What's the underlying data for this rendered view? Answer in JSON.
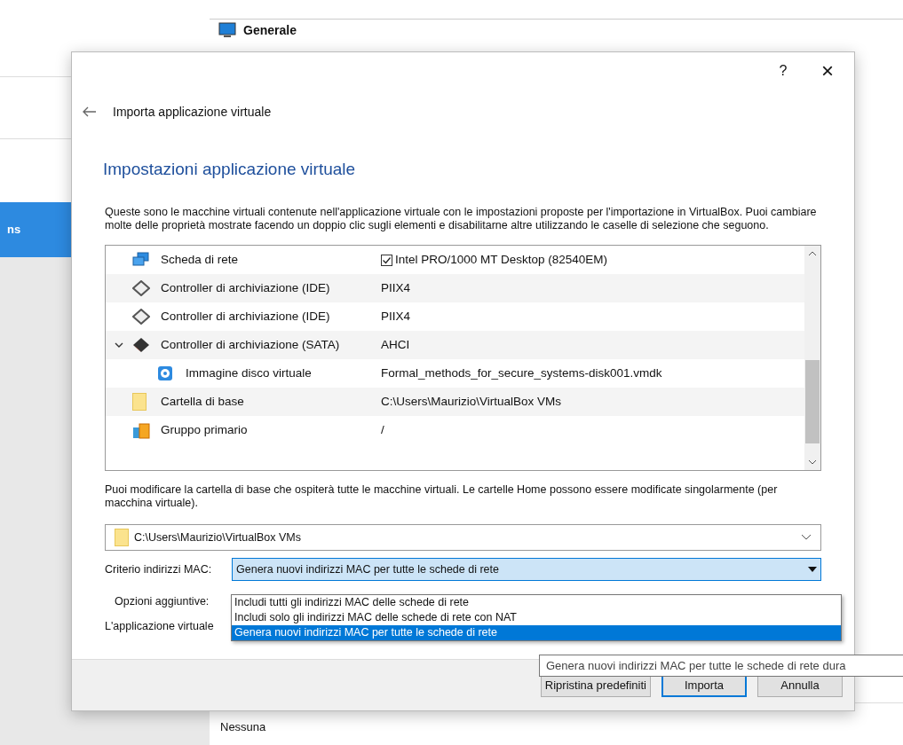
{
  "background": {
    "sidebar": {
      "selected_item": "ns"
    },
    "section": {
      "title": "Generale"
    },
    "footer_value": "Nessuna"
  },
  "dialog": {
    "help": "?",
    "close": "×",
    "back_title": "Importa applicazione virtuale",
    "heading": "Impostazioni applicazione virtuale",
    "intro": "Queste sono le macchine virtuali contenute nell'applicazione virtuale con le impostazioni proposte per l'importazione in VirtualBox. Puoi cambiare molte delle proprietà mostrate facendo un doppio clic sugli elementi e disabilitarne altre utilizzando le caselle di selezione che seguono.",
    "tree": [
      {
        "kind": "network",
        "label": "Scheda di rete",
        "value": "Intel PRO/1000 MT Desktop (82540EM)",
        "checked": true
      },
      {
        "kind": "ide",
        "label": "Controller di archiviazione (IDE)",
        "value": "PIIX4"
      },
      {
        "kind": "ide",
        "label": "Controller di archiviazione (IDE)",
        "value": "PIIX4"
      },
      {
        "kind": "sata",
        "label": "Controller di archiviazione (SATA)",
        "value": "AHCI",
        "expanded": true,
        "children": [
          {
            "kind": "disk",
            "label": "Immagine disco virtuale",
            "value": "Formal_methods_for_secure_systems-disk001.vmdk"
          }
        ]
      },
      {
        "kind": "folder",
        "label": "Cartella di base",
        "value": "C:\\Users\\Maurizio\\VirtualBox VMs"
      },
      {
        "kind": "group",
        "label": "Gruppo primario",
        "value": "/"
      }
    ],
    "base_note": "Puoi modificare la cartella di base che ospiterà tutte le macchine virtuali. Le cartelle Home possono essere modificate singolarmente (per macchina virtuale).",
    "base_folder": "C:\\Users\\Maurizio\\VirtualBox VMs",
    "mac_policy": {
      "label": "Criterio indirizzi MAC:",
      "value": "Genera nuovi indirizzi MAC per tutte le schede di rete",
      "options": [
        {
          "label": "Includi tutti gli indirizzi MAC delle schede di rete",
          "selected": false
        },
        {
          "label": "Includi solo gli indirizzi MAC delle schede di rete con NAT",
          "selected": false
        },
        {
          "label": "Genera nuovi indirizzi MAC per tutte le schede di rete",
          "selected": true
        }
      ]
    },
    "extra_options_label": "Opzioni aggiuntive:",
    "appliance_label": "L'applicazione virtuale",
    "tooltip": "Genera nuovi indirizzi MAC per tutte le schede di rete dura",
    "buttons": [
      {
        "label": "Ripristina predefiniti",
        "default": false
      },
      {
        "label": "Importa",
        "default": true
      },
      {
        "label": "Annulla",
        "default": false
      }
    ]
  }
}
